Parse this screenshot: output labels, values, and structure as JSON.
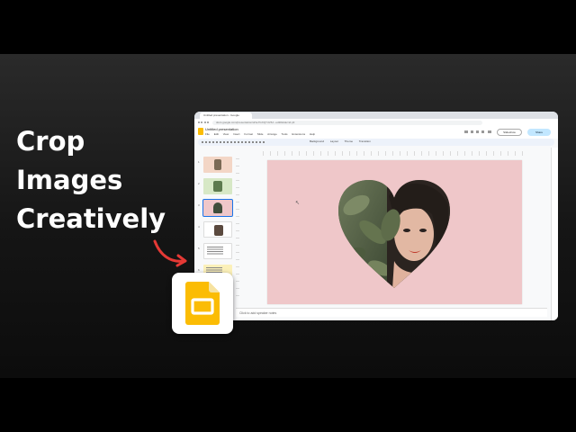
{
  "headline": {
    "line1": "Crop",
    "line2": "Images",
    "line3": "Creatively"
  },
  "browser": {
    "tab_title": "Untitled presentation - Google",
    "url": "docs.google.com/presentation/d/1e7GXQY4V6J...edit#slide=id.p3"
  },
  "app": {
    "name": "Google Slides",
    "doc_title": "Untitled presentation",
    "menu": [
      "File",
      "Edit",
      "View",
      "Insert",
      "Format",
      "Slide",
      "Arrange",
      "Tools",
      "Extensions",
      "Help"
    ],
    "slideshow_label": "Slideshow",
    "share_label": "Share",
    "toolbar_items": [
      "Background",
      "Layout",
      "Theme",
      "Transition"
    ],
    "notes_placeholder": "Click to add speaker notes"
  },
  "filmstrip": {
    "numbers": [
      "1",
      "2",
      "3",
      "4",
      "5",
      "6"
    ],
    "selected": 3
  },
  "colors": {
    "slide_bg": "#efc7c9",
    "accent": "#1a73e8",
    "logo_yellow": "#fbbc04"
  },
  "icons": [
    "slides-logo-icon",
    "arrow-icon",
    "heart-image"
  ]
}
